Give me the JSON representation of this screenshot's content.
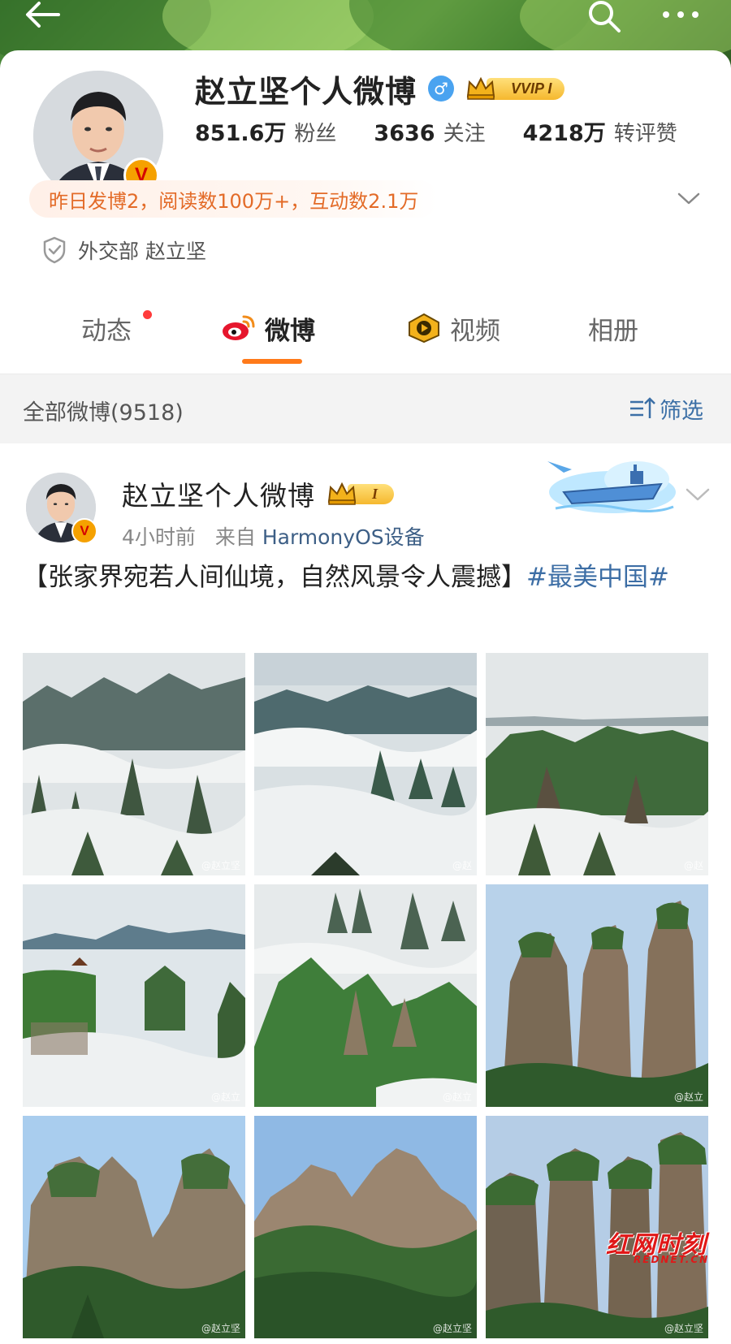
{
  "banner": {
    "colors": {
      "leaf_dark": "#2d5c22",
      "leaf_light": "#8bc25b"
    }
  },
  "profile": {
    "name": "赵立坚个人微博",
    "gender_symbol": "♂",
    "vip_label": "VVIP I",
    "verified_badge": "V",
    "stats": [
      {
        "value": "851.6万",
        "label": "粉丝"
      },
      {
        "value": "3636",
        "label": "关注"
      },
      {
        "value": "4218万",
        "label": "转评赞"
      }
    ],
    "summary": "昨日发博2，阅读数100万+，互动数2.1万",
    "verification": "外交部 赵立坚"
  },
  "tabs": [
    {
      "label": "动态",
      "has_dot": true
    },
    {
      "label": "微博",
      "active": true
    },
    {
      "label": "视频"
    },
    {
      "label": "相册"
    }
  ],
  "filter_bar": {
    "all_label": "全部微博(9518)",
    "filter_label": "筛选"
  },
  "post": {
    "author": "赵立坚个人微博",
    "level_label": "I",
    "time": "4小时前",
    "source_prefix": "来自",
    "source": "HarmonyOS设备",
    "text_plain": "【张家界宛若人间仙境，自然风景令人震撼】",
    "hashtag": "#最美中国#",
    "images": [
      {
        "kind": "mist",
        "wm": "@赵立坚"
      },
      {
        "kind": "mist-sea",
        "wm": "@赵"
      },
      {
        "kind": "mist-green",
        "wm": "@赵"
      },
      {
        "kind": "pavilion",
        "wm": "@赵立"
      },
      {
        "kind": "mist-peaks",
        "wm": "@赵立"
      },
      {
        "kind": "pillars",
        "wm": "@赵立"
      },
      {
        "kind": "cliffs",
        "wm": "@赵立坚"
      },
      {
        "kind": "ridge",
        "wm": "@赵立坚"
      },
      {
        "kind": "pillars-green",
        "wm": "@赵立坚"
      }
    ]
  },
  "watermark": {
    "logo_text": "红网时刻",
    "logo_sub": "REDNET.CN"
  },
  "colors": {
    "accent_orange": "#ff7a1a",
    "link_blue": "#3d6ea5",
    "summary_orange": "#e36b28"
  }
}
